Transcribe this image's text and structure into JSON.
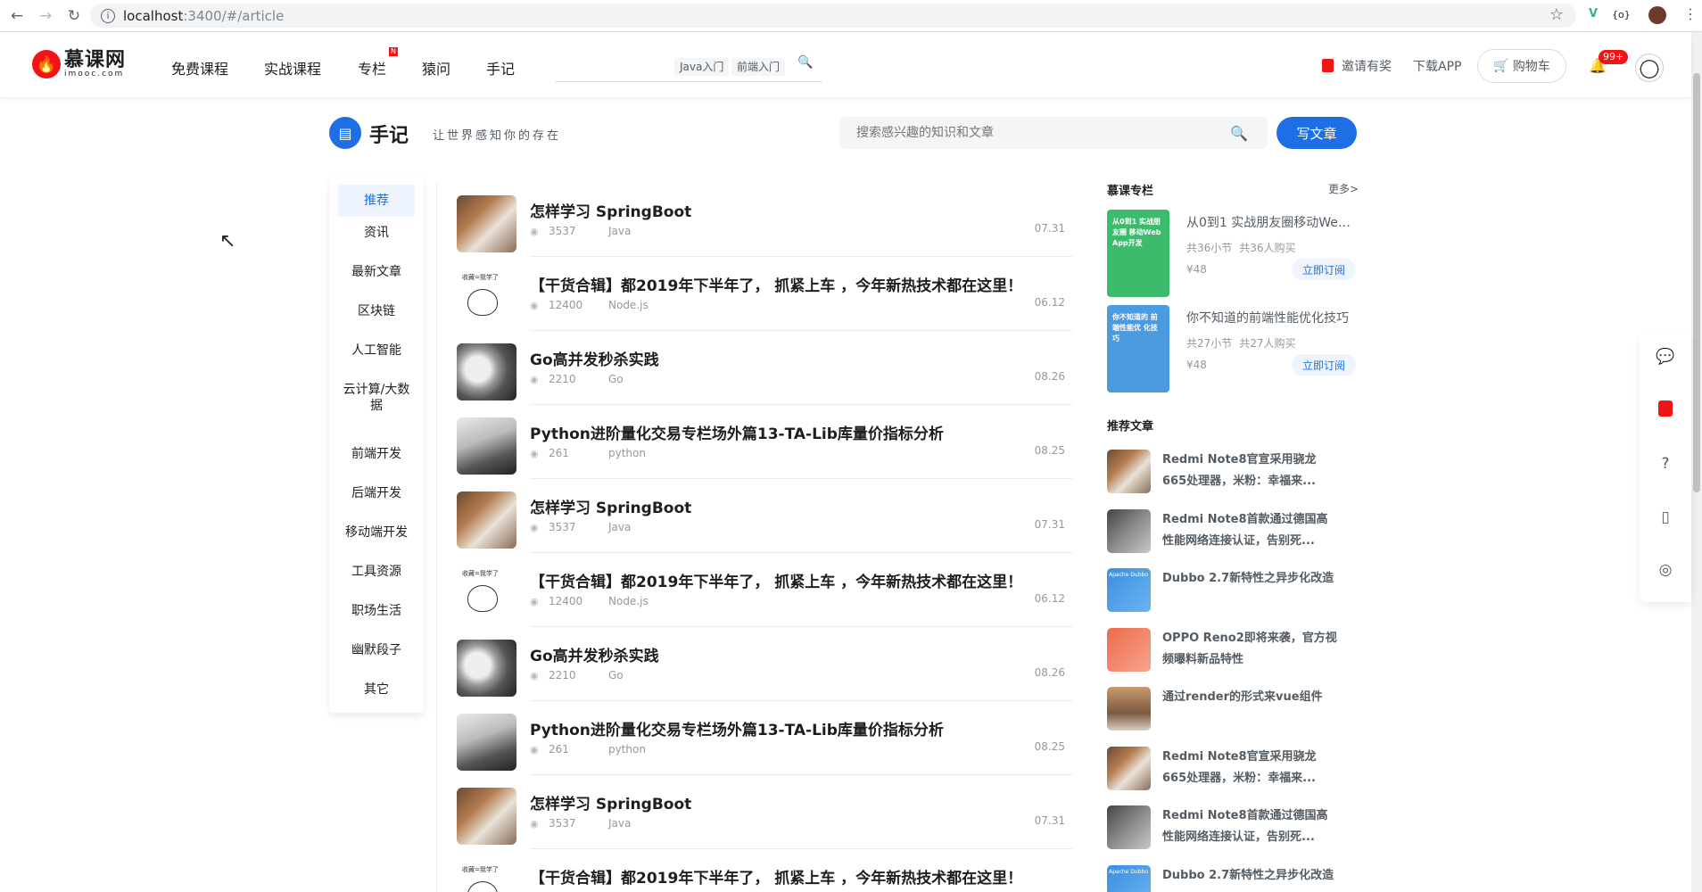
{
  "browser": {
    "url_host": "localhost",
    "url_path": ":3400/#/article"
  },
  "header": {
    "logo_cn": "慕课网",
    "logo_en": "imooc.com",
    "nav": [
      "免费课程",
      "实战课程",
      "专栏",
      "猿问",
      "手记"
    ],
    "nav_badge": "N",
    "hot_tags": [
      "Java入门",
      "前端入门"
    ],
    "invite": "邀请有奖",
    "download": "下载APP",
    "cart": "购物车",
    "bell_badge": "99+"
  },
  "page": {
    "title": "手记",
    "slogan": "让世界感知你的存在",
    "search_placeholder": "搜索感兴趣的知识和文章",
    "write_button": "写文章"
  },
  "categories": [
    "推荐",
    "资讯",
    "最新文章",
    "区块链",
    "人工智能",
    "云计算/大数据",
    "前端开发",
    "后端开发",
    "移动端开发",
    "工具资源",
    "职场生活",
    "幽默段子",
    "其它"
  ],
  "articles": [
    {
      "title": "怎样学习 SpringBoot",
      "views": "3537",
      "tag": "Java",
      "date": "07.31",
      "thumb": "coffee"
    },
    {
      "title": "【干货合辑】都2019年下半年了， 抓紧上车 ，今年新热技术都在这里！",
      "views": "12400",
      "tag": "Node.js",
      "date": "06.12",
      "thumb": "bear",
      "thumb_text": "收藏=我学了"
    },
    {
      "title": "Go高并发秒杀实践",
      "views": "2210",
      "tag": "Go",
      "date": "08.26",
      "thumb": "face"
    },
    {
      "title": "Python进阶量化交易专栏场外篇13-TA-Lib库量价指标分析",
      "views": "261",
      "tag": "python",
      "date": "08.25",
      "thumb": "laptop"
    },
    {
      "title": "怎样学习 SpringBoot",
      "views": "3537",
      "tag": "Java",
      "date": "07.31",
      "thumb": "coffee"
    },
    {
      "title": "【干货合辑】都2019年下半年了， 抓紧上车 ，今年新热技术都在这里！",
      "views": "12400",
      "tag": "Node.js",
      "date": "06.12",
      "thumb": "bear",
      "thumb_text": "收藏=我学了"
    },
    {
      "title": "Go高并发秒杀实践",
      "views": "2210",
      "tag": "Go",
      "date": "08.26",
      "thumb": "face"
    },
    {
      "title": "Python进阶量化交易专栏场外篇13-TA-Lib库量价指标分析",
      "views": "261",
      "tag": "python",
      "date": "08.25",
      "thumb": "laptop"
    },
    {
      "title": "怎样学习 SpringBoot",
      "views": "3537",
      "tag": "Java",
      "date": "07.31",
      "thumb": "coffee"
    },
    {
      "title": "【干货合辑】都2019年下半年了， 抓紧上车 ，今年新热技术都在这里！",
      "views": "",
      "tag": "",
      "date": "",
      "thumb": "bear",
      "thumb_text": "收藏=我学了"
    }
  ],
  "sidebar": {
    "columns_title": "慕课专栏",
    "more": "更多>",
    "columns": [
      {
        "cover_text": "从0到1 实战朋友圈 移动Web App开发",
        "title": "从0到1 实战朋友圈移动Web...",
        "hours": "共36小节",
        "buyers": "共36人购买",
        "price": "¥48",
        "button": "立即订阅",
        "color": "#3dbb6c"
      },
      {
        "cover_text": "你不知道的 前端性能优 化技巧",
        "title": "你不知道的前端性能优化技巧",
        "hours": "共27小节",
        "buyers": "共27人购买",
        "price": "¥48",
        "button": "立即订阅",
        "color": "#4a9be0"
      }
    ],
    "recommend_title": "推荐文章",
    "recommend": [
      {
        "title": "Redmi Note8官宣采用骁龙665处理器，米粉：幸福来...",
        "thumb": "coffee"
      },
      {
        "title": "Redmi Note8首款通过德国高性能网络连接认证，告别死...",
        "thumb": "man"
      },
      {
        "title": "Dubbo 2.7新特性之异步化改造",
        "thumb": "blue",
        "thumb_text": "Apache Dubbo"
      },
      {
        "title": "OPPO Reno2即将来袭，官方视频曝料新品特性",
        "thumb": "orange"
      },
      {
        "title": "通过render的形式来vue组件",
        "thumb": "sunset"
      },
      {
        "title": "Redmi Note8官宣采用骁龙665处理器，米粉：幸福来...",
        "thumb": "coffee"
      },
      {
        "title": "Redmi Note8首款通过德国高性能网络连接认证，告别死...",
        "thumb": "man"
      },
      {
        "title": "Dubbo 2.7新特性之异步化改造",
        "thumb": "blue",
        "thumb_text": "Apache Dubbo"
      }
    ]
  },
  "float_icons": [
    "chat-icon",
    "gift-icon",
    "help-icon",
    "phone-icon",
    "wechat-icon"
  ]
}
